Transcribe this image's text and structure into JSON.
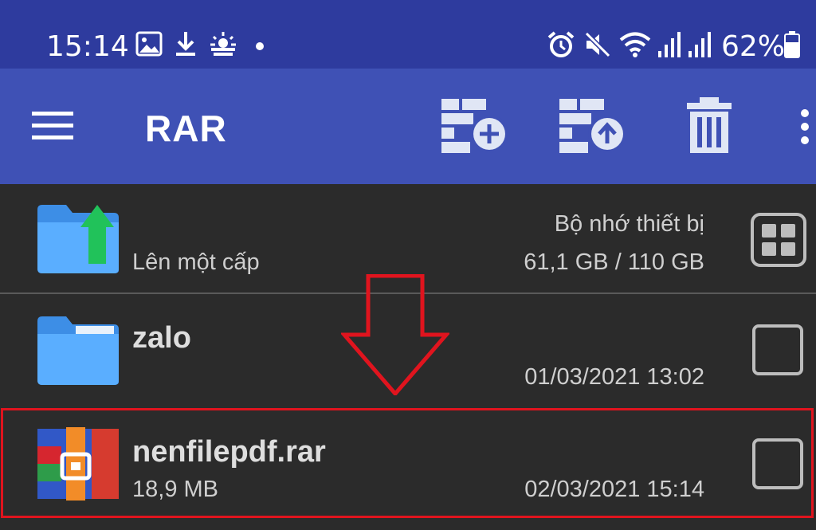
{
  "status_bar": {
    "time": "15:14",
    "battery_percent": "62%",
    "left_icons": [
      "image-icon",
      "download-icon",
      "weather-icon",
      "dot-icon"
    ],
    "right_icons": [
      "alarm-icon",
      "mute-icon",
      "wifi-icon",
      "signal-icon",
      "signal-icon",
      "battery-icon"
    ]
  },
  "app_bar": {
    "title": "RAR",
    "actions": [
      "add-to-archive-icon",
      "extract-icon",
      "delete-icon",
      "more-options-icon"
    ]
  },
  "parent_row": {
    "label": "Lên một cấp",
    "storage_label": "Bộ nhớ thiết bị",
    "storage_usage": "61,1 GB / 110 GB"
  },
  "files": [
    {
      "name": "zalo",
      "size": "",
      "date": "01/03/2021 13:02",
      "type": "folder"
    },
    {
      "name": "nenfilepdf.rar",
      "size": "18,9 MB",
      "date": "02/03/2021 15:14",
      "type": "rar"
    }
  ],
  "colors": {
    "status_bar": "#2e3b9e",
    "app_bar": "#3f51b5",
    "background": "#2b2b2b",
    "folder": "#4fa3f7",
    "highlight": "#e0141e"
  }
}
